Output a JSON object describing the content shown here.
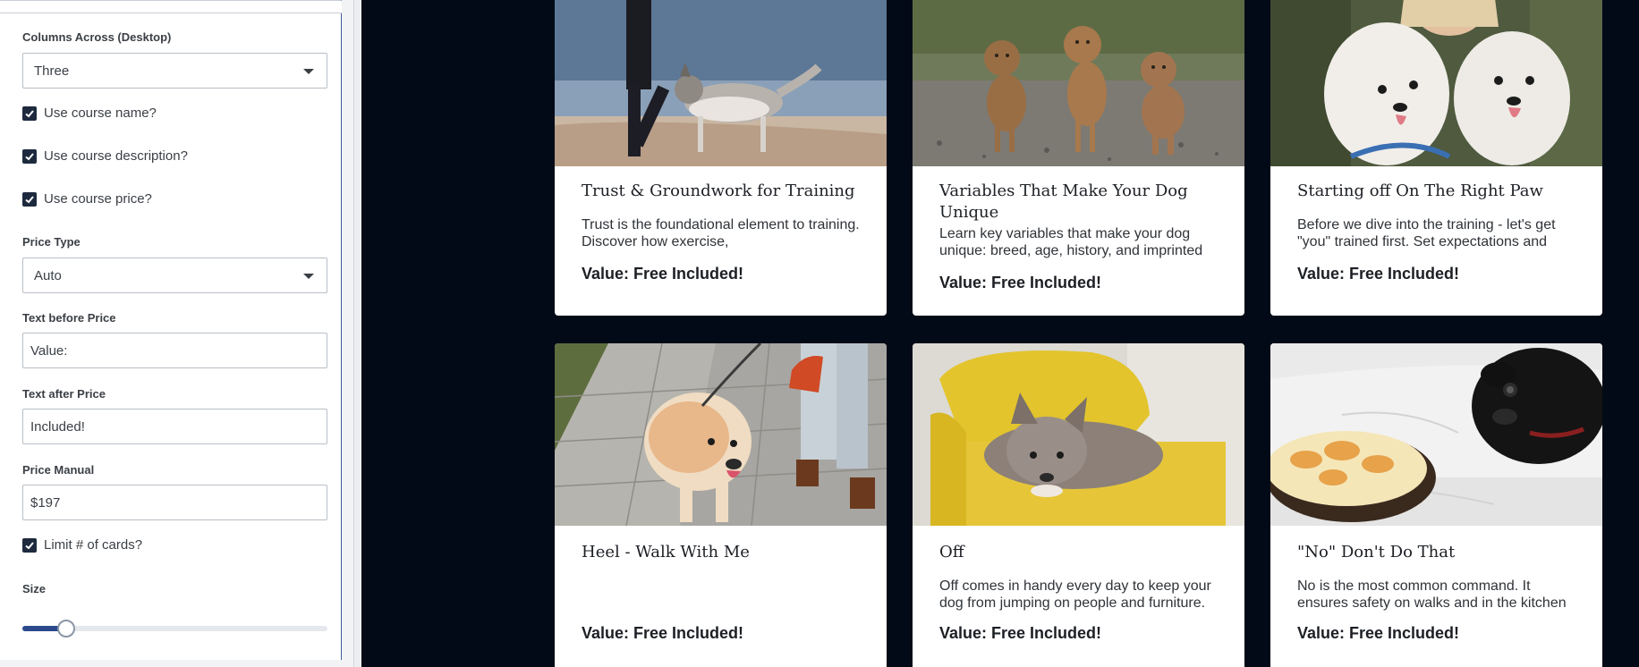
{
  "sidebar": {
    "columns_label": "Columns Across (Desktop)",
    "columns_value": "Three",
    "use_name_label": "Use course name?",
    "use_description_label": "Use course description?",
    "use_price_label": "Use course price?",
    "price_type_label": "Price Type",
    "price_type_value": "Auto",
    "text_before_label": "Text before Price",
    "text_before_value": "Value:",
    "text_after_label": "Text after Price",
    "text_after_value": "Included!",
    "price_manual_label": "Price Manual",
    "price_manual_value": "$197",
    "limit_cards_label": "Limit # of cards?",
    "size_label": "Size",
    "size_value_fraction": 0.12
  },
  "cards": [
    {
      "title": "Trust & Groundwork for Training",
      "description": "Trust is the foundational element to training. Discover how exercise,",
      "price_text": "Value: Free Included!",
      "image": "person-walking-husky-on-beach"
    },
    {
      "title": "Variables That Make Your Dog Unique",
      "description": "Learn key variables that make your dog unique: breed, age, history, and imprinted",
      "price_text": "Value: Free Included!",
      "image": "three-puppies-on-gravel"
    },
    {
      "title": "Starting off On The Right Paw",
      "description": "Before we dive into the training - let's get \"you\" trained first. Set expectations and",
      "price_text": "Value: Free Included!",
      "image": "woman-hugging-samoyeds"
    },
    {
      "title": "Heel - Walk With Me",
      "description": "",
      "price_text": "Value: Free Included!",
      "image": "golden-retriever-on-leash"
    },
    {
      "title": "Off",
      "description": "Off comes in handy every day to keep your dog from jumping on people and furniture.",
      "price_text": "Value: Free Included!",
      "image": "dog-on-yellow-chair"
    },
    {
      "title": "\"No\" Don't Do That",
      "description": "No is the most common command. It ensures safety on walks and in the kitchen",
      "price_text": "Value: Free Included!",
      "image": "pug-looking-at-pie"
    }
  ],
  "colors": {
    "page_background": "#020a17",
    "checkbox": "#1d2a3e",
    "slider_fill": "#2b4a8c",
    "panel_border": "#3d5a99"
  }
}
